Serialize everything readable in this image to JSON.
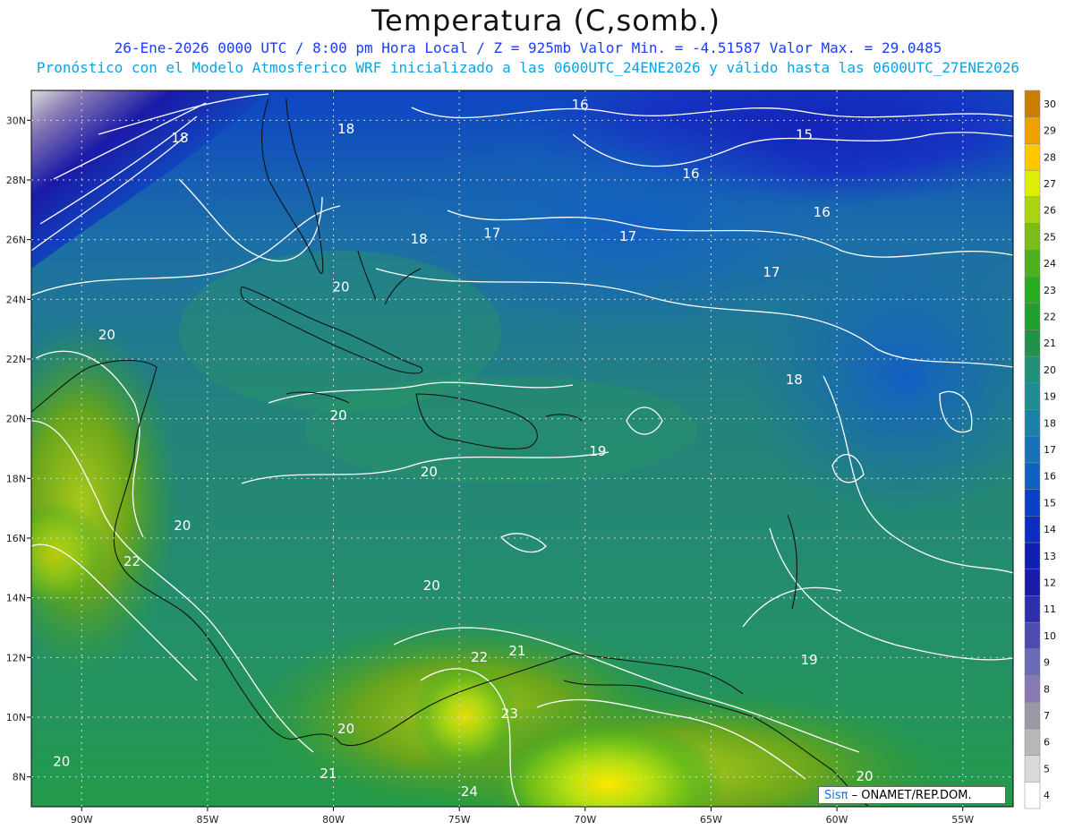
{
  "title": "Temperatura (C,somb.)",
  "subtitle_line1": "26-Ene-2026  0000 UTC / 8:00 pm Hora Local / Z = 925mb   Valor Min. = -4.51587  Valor Max. = 29.0485",
  "subtitle_line2": "Pronóstico con el Modelo Atmosferico WRF inicializado a las 0600UTC_24ENE2026 y válido hasta las  0600UTC_27ENE2026",
  "credit_brand": "Sisπ",
  "credit_text": " – ONAMET/REP.DOM.",
  "map": {
    "lon_range": [
      -92,
      -53
    ],
    "lat_range": [
      7,
      31
    ],
    "lon_ticks": [
      -90,
      -85,
      -80,
      -75,
      -70,
      -65,
      -60,
      -55
    ],
    "lon_tick_labels": [
      "90W",
      "85W",
      "80W",
      "75W",
      "70W",
      "65W",
      "60W",
      "55W"
    ],
    "lat_ticks": [
      8,
      10,
      12,
      14,
      16,
      18,
      20,
      22,
      24,
      26,
      28,
      30
    ],
    "lat_tick_labels": [
      "8N",
      "10N",
      "12N",
      "14N",
      "16N",
      "18N",
      "20N",
      "22N",
      "24N",
      "26N",
      "28N",
      "30N"
    ],
    "contour_labels": [
      {
        "text": "16",
        "lon": -70.2,
        "lat": 30.5
      },
      {
        "text": "15",
        "lon": -61.3,
        "lat": 29.5
      },
      {
        "text": "16",
        "lon": -65.8,
        "lat": 28.2
      },
      {
        "text": "16",
        "lon": -60.6,
        "lat": 26.9
      },
      {
        "text": "17",
        "lon": -73.7,
        "lat": 26.2
      },
      {
        "text": "17",
        "lon": -68.3,
        "lat": 26.1
      },
      {
        "text": "17",
        "lon": -62.6,
        "lat": 24.9
      },
      {
        "text": "18",
        "lon": -76.6,
        "lat": 26.0
      },
      {
        "text": "18",
        "lon": -79.5,
        "lat": 29.7
      },
      {
        "text": "18",
        "lon": -86.1,
        "lat": 29.4
      },
      {
        "text": "18",
        "lon": -61.7,
        "lat": 21.3
      },
      {
        "text": "19",
        "lon": -69.5,
        "lat": 18.9
      },
      {
        "text": "19",
        "lon": -61.1,
        "lat": 11.9
      },
      {
        "text": "20",
        "lon": -79.7,
        "lat": 24.4
      },
      {
        "text": "20",
        "lon": -89.0,
        "lat": 22.8
      },
      {
        "text": "20",
        "lon": -79.8,
        "lat": 20.1
      },
      {
        "text": "20",
        "lon": -76.2,
        "lat": 18.2
      },
      {
        "text": "20",
        "lon": -86.0,
        "lat": 16.4
      },
      {
        "text": "20",
        "lon": -76.1,
        "lat": 14.4
      },
      {
        "text": "20",
        "lon": -79.5,
        "lat": 9.6
      },
      {
        "text": "20",
        "lon": -90.8,
        "lat": 8.5
      },
      {
        "text": "20",
        "lon": -58.9,
        "lat": 8.0
      },
      {
        "text": "21",
        "lon": -72.7,
        "lat": 12.2
      },
      {
        "text": "21",
        "lon": -80.2,
        "lat": 8.1
      },
      {
        "text": "22",
        "lon": -88.0,
        "lat": 15.2
      },
      {
        "text": "22",
        "lon": -74.2,
        "lat": 12.0
      },
      {
        "text": "23",
        "lon": -73.0,
        "lat": 10.1
      },
      {
        "text": "24",
        "lon": -74.6,
        "lat": 7.5
      }
    ]
  },
  "colorbar": {
    "levels": [
      4,
      5,
      6,
      7,
      8,
      9,
      10,
      11,
      12,
      13,
      14,
      15,
      16,
      17,
      18,
      19,
      20,
      21,
      22,
      23,
      24,
      25,
      26,
      27,
      28,
      29,
      30
    ],
    "labels": [
      "4",
      "5",
      "6",
      "7",
      "8",
      "9",
      "10",
      "11",
      "12",
      "13",
      "14",
      "15",
      "16",
      "17",
      "18",
      "19",
      "20",
      "21",
      "22",
      "23",
      "24",
      "25",
      "26",
      "27",
      "28",
      "29",
      "30"
    ],
    "colors": [
      "#ffffff",
      "#d9d9d9",
      "#b8b8b8",
      "#9a9aa6",
      "#8878b4",
      "#6a6ab6",
      "#4b4bb0",
      "#2e2eaa",
      "#1a1aa8",
      "#0f1fb4",
      "#0a2cc0",
      "#0a3fc8",
      "#125fc4",
      "#1772b8",
      "#1a82a8",
      "#1f8c92",
      "#228f78",
      "#22924a",
      "#1ea030",
      "#25ac20",
      "#4db01c",
      "#7dbb18",
      "#a9d40f",
      "#dcee08",
      "#ffc800",
      "#f0a000",
      "#c87f00"
    ]
  }
}
